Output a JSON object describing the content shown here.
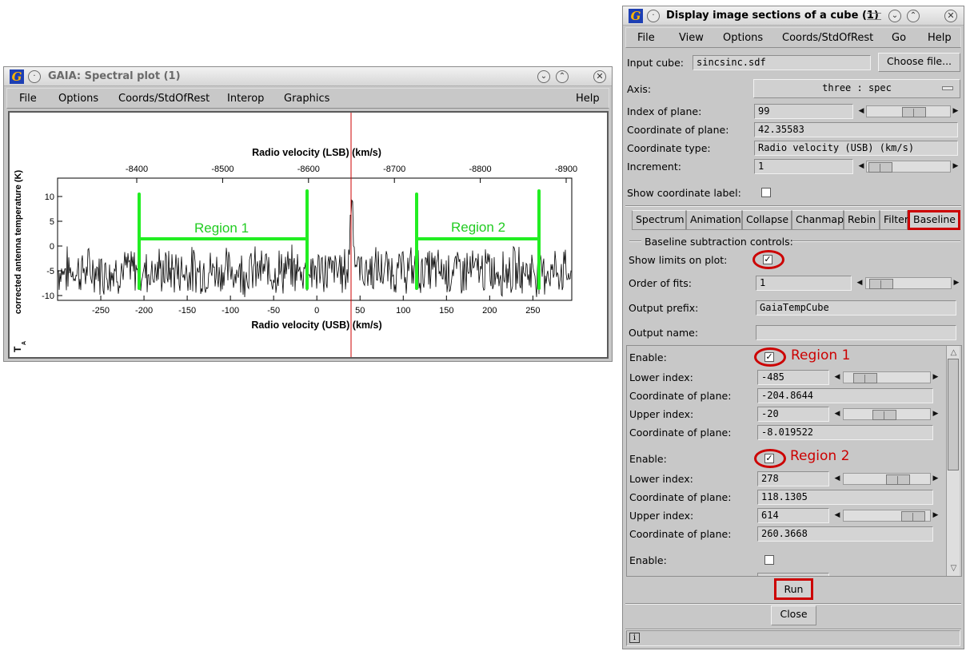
{
  "spectral": {
    "title": "GAIA: Spectral plot (1)",
    "menu": [
      "File",
      "Options",
      "Coords/StdOfRest",
      "Interop",
      "Graphics",
      "Help"
    ],
    "plot": {
      "top_axis_label": "Radio velocity (LSB) (km/s)",
      "bottom_axis_label": "Radio velocity (USB) (km/s)",
      "y_axis_label": "corrected antenna temperature (K)",
      "y_symbol": "T",
      "y_symbol_sub": "A",
      "top_ticks": [
        "-8400",
        "-8500",
        "-8600",
        "-8700",
        "-8800",
        "-8900"
      ],
      "bottom_ticks": [
        "-250",
        "-200",
        "-150",
        "-100",
        "-50",
        "0",
        "50",
        "100",
        "150",
        "200",
        "250"
      ],
      "y_ticks": [
        "10",
        "5",
        "0",
        "-5",
        "-10"
      ],
      "region1_label": "Region 1",
      "region2_label": "Region 2",
      "line_color": "#000000",
      "marker_color": "#cc0000",
      "region_color": "#22ee22"
    }
  },
  "cube": {
    "title": "Display image sections of a cube (1)",
    "menu": [
      "File",
      "View",
      "Options",
      "Coords/StdOfRest",
      "Go",
      "Help"
    ],
    "input_cube_label": "Input cube:",
    "input_cube_value": "sincsinc.sdf",
    "choose_file": "Choose file...",
    "axis_label": "Axis:",
    "axis_value": "three : spec",
    "index_label": "Index of plane:",
    "index_value": "99",
    "coord_label": "Coordinate of plane:",
    "coord_value": "42.35583",
    "coord_type_label": "Coordinate type:",
    "coord_type_value": "Radio velocity (USB) (km/s)",
    "increment_label": "Increment:",
    "increment_value": "1",
    "show_coord_label": "Show coordinate label:",
    "tabs": [
      "Spectrum",
      "Animation",
      "Collapse",
      "Chanmap",
      "Rebin",
      "Filter",
      "Baseline"
    ],
    "baseline": {
      "group_title": "Baseline subtraction controls:",
      "show_limits_label": "Show limits on plot:",
      "order_label": "Order of fits:",
      "order_value": "1",
      "prefix_label": "Output prefix:",
      "prefix_value": "GaiaTempCube",
      "name_label": "Output name:",
      "name_value": "",
      "enable_label": "Enable:",
      "lower_label": "Lower index:",
      "upper_label": "Upper index:",
      "coord_label": "Coordinate of plane:",
      "region1": {
        "tag": "Region 1",
        "lower": "-485",
        "lower_coord": "-204.8644",
        "upper": "-20",
        "upper_coord": "-8.019522"
      },
      "region2": {
        "tag": "Region 2",
        "lower": "278",
        "lower_coord": "118.1305",
        "upper": "614",
        "upper_coord": "260.3668"
      }
    },
    "run": "Run",
    "close": "Close",
    "info_icon": "i"
  }
}
